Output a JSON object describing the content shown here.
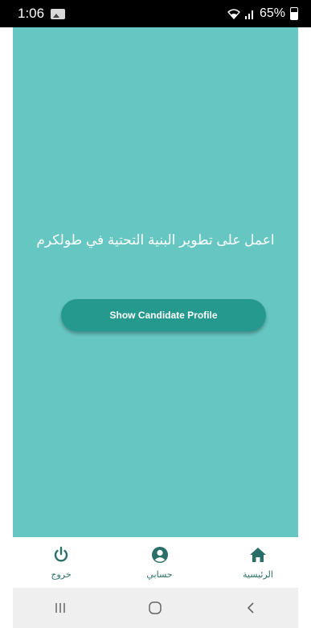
{
  "status_bar": {
    "time": "1:06",
    "battery": "65%",
    "icons": [
      "gallery-icon",
      "wifi-icon",
      "signal-icon",
      "battery-icon"
    ]
  },
  "main": {
    "headline": "اعمل على تطوير البنية التحتية في طولكرم",
    "cta_label": "Show Candidate Profile"
  },
  "bottom_nav": {
    "items": [
      {
        "label": "خروج",
        "icon": "power-icon"
      },
      {
        "label": "حسابي",
        "icon": "account-icon"
      },
      {
        "label": "الرئيسية",
        "icon": "home-icon"
      }
    ]
  },
  "colors": {
    "background": "#66c6c2",
    "button": "#26998e",
    "nav_icon": "#2a6f67"
  }
}
